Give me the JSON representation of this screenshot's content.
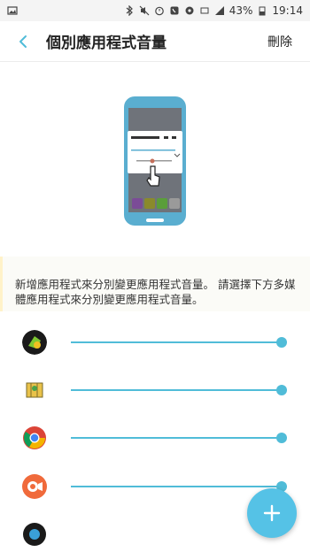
{
  "status_bar": {
    "battery": "43%",
    "time": "19:14"
  },
  "header": {
    "title": "個別應用程式音量",
    "delete_label": "刪除"
  },
  "description": "新增應用程式來分別變更應用程式音量。 請選擇下方多媒體應用程式來分別變更應用程式音量。",
  "apps": [
    {
      "name": "app-1",
      "volume": 1.0
    },
    {
      "name": "app-2-map",
      "volume": 1.0
    },
    {
      "name": "chrome",
      "volume": 1.0
    },
    {
      "name": "video-app",
      "volume": 1.0
    }
  ],
  "colors": {
    "accent": "#50bcd8",
    "fab": "#55c2e6"
  },
  "icons": {
    "back": "chevron-left-icon",
    "add": "plus-icon"
  }
}
